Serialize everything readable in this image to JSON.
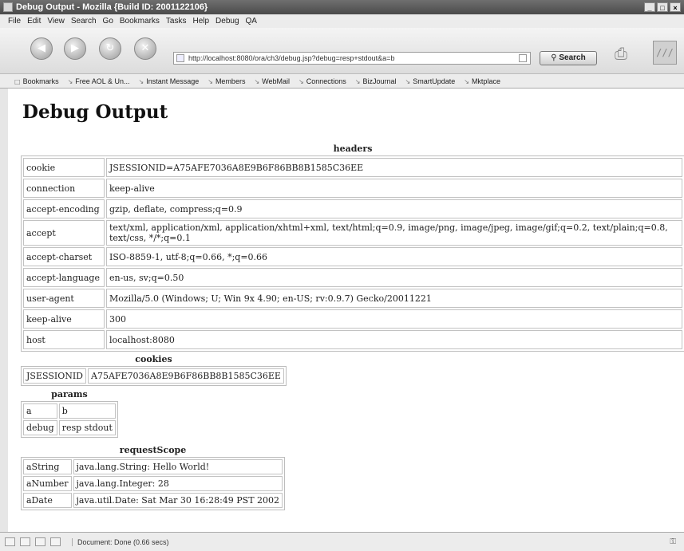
{
  "window": {
    "title": "Debug Output - Mozilla {Build ID: 2001122106}"
  },
  "menu": [
    "File",
    "Edit",
    "View",
    "Search",
    "Go",
    "Bookmarks",
    "Tasks",
    "Help",
    "Debug",
    "QA"
  ],
  "nav": {
    "url": "http://localhost:8080/ora/ch3/debug.jsp?debug=resp+stdout&a=b",
    "search_label": "Search"
  },
  "bookmarks": [
    "Bookmarks",
    "Free AOL & Un...",
    "Instant Message",
    "Members",
    "WebMail",
    "Connections",
    "BizJournal",
    "SmartUpdate",
    "Mktplace"
  ],
  "page": {
    "title": "Debug Output",
    "headers": {
      "caption": "headers",
      "rows": [
        {
          "key": "cookie",
          "value": "JSESSIONID=A75AFE7036A8E9B6F86BB8B1585C36EE"
        },
        {
          "key": "connection",
          "value": "keep-alive"
        },
        {
          "key": "accept-encoding",
          "value": "gzip, deflate, compress;q=0.9"
        },
        {
          "key": "accept",
          "value": "text/xml, application/xml, application/xhtml+xml, text/html;q=0.9, image/png, image/jpeg, image/gif;q=0.2, text/plain;q=0.8, text/css, */*;q=0.1"
        },
        {
          "key": "accept-charset",
          "value": "ISO-8859-1, utf-8;q=0.66, *;q=0.66"
        },
        {
          "key": "accept-language",
          "value": "en-us, sv;q=0.50"
        },
        {
          "key": "user-agent",
          "value": "Mozilla/5.0 (Windows; U; Win 9x 4.90; en-US; rv:0.9.7) Gecko/20011221"
        },
        {
          "key": "keep-alive",
          "value": "300"
        },
        {
          "key": "host",
          "value": "localhost:8080"
        }
      ]
    },
    "cookies": {
      "caption": "cookies",
      "rows": [
        {
          "key": "JSESSIONID",
          "value": "A75AFE7036A8E9B6F86BB8B1585C36EE"
        }
      ]
    },
    "params": {
      "caption": "params",
      "rows": [
        {
          "key": "a",
          "value": "b"
        },
        {
          "key": "debug",
          "value": "resp stdout"
        }
      ]
    },
    "requestScope": {
      "caption": "requestScope",
      "rows": [
        {
          "key": "aString",
          "value": "java.lang.String: Hello World!"
        },
        {
          "key": "aNumber",
          "value": "java.lang.Integer: 28"
        },
        {
          "key": "aDate",
          "value": "java.util.Date: Sat Mar 30 16:28:49 PST 2002"
        }
      ]
    }
  },
  "status": {
    "text": "Document: Done (0.66 secs)"
  }
}
